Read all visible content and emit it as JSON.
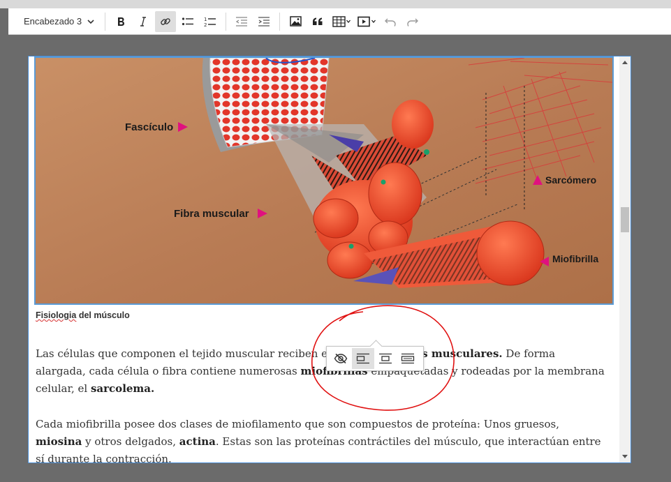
{
  "toolbar": {
    "heading_select": "Encabezado 3",
    "buttons": [
      {
        "name": "bold",
        "icon": "bold-icon"
      },
      {
        "name": "italic",
        "icon": "italic-icon"
      },
      {
        "name": "link",
        "icon": "link-icon",
        "active": true
      },
      {
        "name": "bulleted-list",
        "icon": "bulleted-list-icon"
      },
      {
        "name": "numbered-list",
        "icon": "numbered-list-icon"
      },
      {
        "name": "outdent",
        "icon": "outdent-icon"
      },
      {
        "name": "indent",
        "icon": "indent-icon"
      },
      {
        "name": "insert-image",
        "icon": "image-icon"
      },
      {
        "name": "block-quote",
        "icon": "quote-icon"
      },
      {
        "name": "insert-table",
        "icon": "table-icon"
      },
      {
        "name": "insert-media",
        "icon": "media-icon"
      },
      {
        "name": "undo",
        "icon": "undo-icon"
      },
      {
        "name": "redo",
        "icon": "redo-icon"
      }
    ]
  },
  "figure": {
    "labels": {
      "fasciculo": "Fascículo",
      "fibra": "Fibra muscular",
      "sarcomero": "Sarcómero",
      "miofibrilla": "Miofibrilla"
    },
    "caption_word1": "Fisiologia",
    "caption_rest": " del músculo"
  },
  "content": {
    "p1_a": "Las células que componen el tejido muscular reciben el nombre de ",
    "p1_b": "fibras musculares.",
    "p1_c": " De forma alargada, cada célula o fibra contiene numerosas ",
    "p1_d": "miofibrillas",
    "p1_e": " empaquetadas y rodeadas por la membrana celular, el ",
    "p1_f": "sarcolema.",
    "p2_a": "Cada miofibrilla posee dos clases de miofilamento que son compuestos de proteína: Unos gruesos, ",
    "p2_b": "miosina",
    "p2_c": " y otros delgados, ",
    "p2_d": "actina",
    "p2_e": ". Estas son las proteínas contráctiles del músculo, que interactúan entre sí durante la contracción."
  },
  "image_toolbar": {
    "buttons": [
      {
        "name": "toggle-caption",
        "icon": "eye-off-icon"
      },
      {
        "name": "align-left",
        "icon": "align-left-icon",
        "active": true
      },
      {
        "name": "align-center",
        "icon": "align-center-icon"
      },
      {
        "name": "align-full",
        "icon": "align-full-icon"
      }
    ]
  },
  "colors": {
    "accent": "#4a8fd8",
    "annotation": "#e01010",
    "label_arrow": "#e0117f",
    "muscle_red": "#e8452a"
  }
}
